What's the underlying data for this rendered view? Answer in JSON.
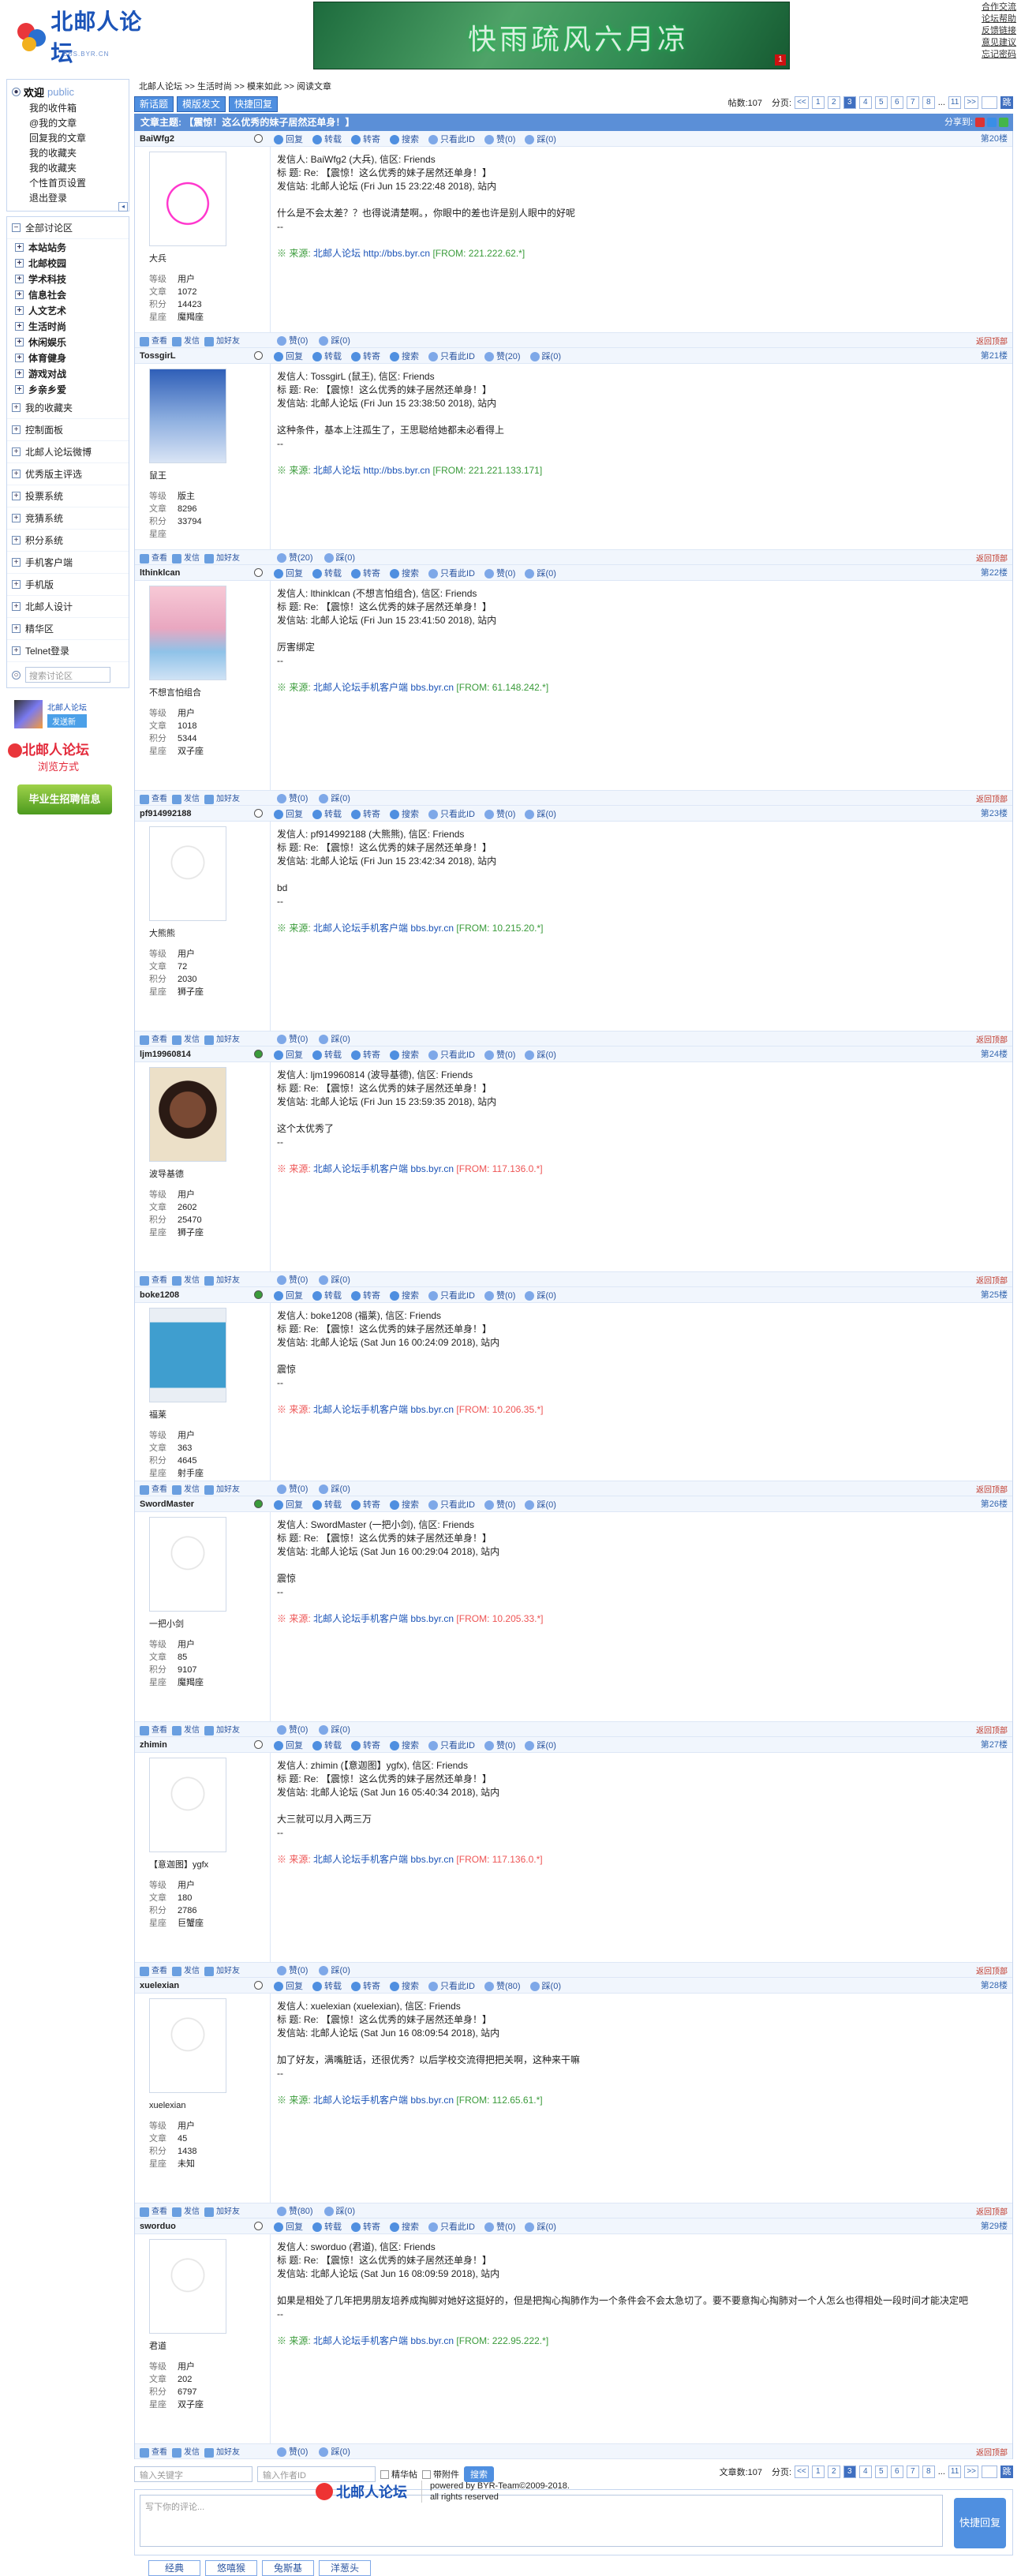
{
  "site": {
    "logo_text": "北邮人论坛",
    "logo_sub": "BBS.BYR.CN",
    "banner_text": "快雨疏风六月凉",
    "banner_badge": "1",
    "top_links": [
      "合作交流",
      "论坛帮助",
      "反馈链接",
      "意见建议",
      "忘记密码"
    ]
  },
  "sidebar": {
    "welcome_title": "欢迎",
    "welcome_user": "public",
    "welcome_links": [
      "我的收件箱",
      "@我的文章",
      "回复我的文章",
      "我的收藏夹",
      "我的收藏夹",
      "个性首页设置",
      "退出登录"
    ],
    "nav": [
      {
        "label": "全部讨论区",
        "boards": [
          "本站站务",
          "北邮校园",
          "学术科技",
          "信息社会",
          "人文艺术",
          "生活时尚",
          "休闲娱乐",
          "体育健身",
          "游戏对战",
          "乡亲乡爱"
        ]
      },
      {
        "label": "我的收藏夹"
      },
      {
        "label": "控制面板"
      },
      {
        "label": "北邮人论坛微博"
      },
      {
        "label": "优秀版主评选"
      },
      {
        "label": "投票系统"
      },
      {
        "label": "竞猜系统"
      },
      {
        "label": "积分系统"
      },
      {
        "label": "手机客户端"
      },
      {
        "label": "手机版"
      },
      {
        "label": "北邮人设计"
      },
      {
        "label": "精华区"
      },
      {
        "label": "Telnet登录"
      }
    ],
    "search_placeholder": "搜索讨论区",
    "ad_client": {
      "title": "北邮人论坛",
      "button": "发送新"
    },
    "ad_browse": {
      "line1": "北邮人论坛",
      "line2": "浏览方式"
    },
    "ad_job": "毕业生招聘信息"
  },
  "main": {
    "breadcrumb": [
      "北邮人论坛",
      ">>",
      "生活时尚",
      ">>",
      "模来如此",
      ">>",
      "阅读文章"
    ],
    "buttons": {
      "new_post": "新话题",
      "forward": "模版发文",
      "quick_reply": "快捷回复"
    },
    "post_count_label": "帖数:107",
    "pager_label": "分页:",
    "pages": [
      "<<",
      "1",
      "2",
      "3",
      "4",
      "5",
      "6",
      "7",
      "8",
      "...",
      "11",
      ">>"
    ],
    "current_page": "3",
    "go_label": "跳",
    "subject": "文章主题: 【震惊！这么优秀的妹子居然还单身！】",
    "share_label": "分享到:",
    "actions": {
      "reply": "回复",
      "forward": "转载",
      "cross": "转寄",
      "search": "搜索",
      "only_author": "只看此ID",
      "like": "赞",
      "dislike": "踩"
    },
    "user_actions": {
      "view": "查看",
      "message": "发信",
      "add_friend": "加好友"
    },
    "to_top": "返回顶部",
    "stat_labels": {
      "level": "等级",
      "posts": "文章",
      "score": "积分",
      "star": "星座"
    }
  },
  "posts": [
    {
      "id": "BaiWfg2",
      "floor": "第20楼",
      "nick": "大兵",
      "level": "用户",
      "posts": "1072",
      "score": "14423",
      "star": "魔羯座",
      "online": false,
      "from": "发信人: BaiWfg2 (大兵), 信区: Friends",
      "title": "标  题: Re: 【震惊！这么优秀的妹子居然还单身！】",
      "site": "发信站: 北邮人论坛 (Fri Jun 15 23:22:48 2018), 站内",
      "text": "什么是不会太差？？也得说清楚啊。，你眼中的差也许是别人眼中的好呢",
      "sig": "--",
      "src_prefix": "※ 来源: ",
      "src_name": "北邮人论坛",
      "src_url": "http://bbs.byr.cn",
      "src_from": "[FROM: 221.222.62.*]",
      "src_red": false,
      "top_like": "赞(0)",
      "top_dislike": "踩(0)",
      "bottom_like": "赞(0)",
      "bottom_dislike": "踩(0)"
    },
    {
      "id": "TossgirL",
      "floor": "第21楼",
      "nick": "鼠王",
      "level": "版主",
      "posts": "8296",
      "score": "33794",
      "star": "",
      "online": false,
      "from": "发信人: TossgirL (鼠王), 信区: Friends",
      "title": "标  题: Re: 【震惊！这么优秀的妹子居然还单身！】",
      "site": "发信站: 北邮人论坛 (Fri Jun 15 23:38:50 2018), 站内",
      "text": "这种条件，基本上注孤生了，王思聪给她都未必看得上",
      "sig": "--",
      "src_prefix": "※ 来源: ",
      "src_name": "北邮人论坛",
      "src_url": "http://bbs.byr.cn",
      "src_from": "[FROM: 221.221.133.171]",
      "src_red": false,
      "top_like": "赞(20)",
      "top_dislike": "踩(0)",
      "bottom_like": "赞(20)",
      "bottom_dislike": "踩(0)"
    },
    {
      "id": "lthinklcan",
      "floor": "第22楼",
      "nick": "不想言怕组合",
      "level": "用户",
      "posts": "1018",
      "score": "5344",
      "star": "双子座",
      "online": false,
      "from": "发信人: lthinklcan (不想言怕组合), 信区: Friends",
      "title": "标  题: Re: 【震惊！这么优秀的妹子居然还单身！】",
      "site": "发信站: 北邮人论坛 (Fri Jun 15 23:41:50 2018), 站内",
      "text": "厉害绑定",
      "sig": "--",
      "src_prefix": "※ 来源: ",
      "src_name": "北邮人论坛手机客户端",
      "src_url": "bbs.byr.cn",
      "src_from": "[FROM: 61.148.242.*]",
      "src_red": false,
      "top_like": "赞(0)",
      "top_dislike": "踩(0)",
      "bottom_like": "赞(0)",
      "bottom_dislike": "踩(0)"
    },
    {
      "id": "pf914992188",
      "floor": "第23楼",
      "nick": "大熊熊",
      "level": "用户",
      "posts": "72",
      "score": "2030",
      "star": "狮子座",
      "online": false,
      "from": "发信人: pf914992188 (大熊熊), 信区: Friends",
      "title": "标  题: Re: 【震惊！这么优秀的妹子居然还单身！】",
      "site": "发信站: 北邮人论坛 (Fri Jun 15 23:42:34 2018), 站内",
      "text": "bd",
      "sig": "--",
      "src_prefix": "※ 来源: ",
      "src_name": "北邮人论坛手机客户端",
      "src_url": "bbs.byr.cn",
      "src_from": "[FROM: 10.215.20.*]",
      "src_red": false,
      "top_like": "赞(0)",
      "top_dislike": "踩(0)",
      "bottom_like": "赞(0)",
      "bottom_dislike": "踩(0)"
    },
    {
      "id": "ljm19960814",
      "floor": "第24楼",
      "nick": "波导基德",
      "level": "用户",
      "posts": "2602",
      "score": "25470",
      "star": "狮子座",
      "online": true,
      "from": "发信人: ljm19960814 (波导基德), 信区: Friends",
      "title": "标  题: Re: 【震惊！这么优秀的妹子居然还单身！】",
      "site": "发信站: 北邮人论坛 (Fri Jun 15 23:59:35 2018), 站内",
      "text": "这个太优秀了",
      "sig": "--",
      "src_prefix": "※ 来源: ",
      "src_name": "北邮人论坛手机客户端",
      "src_url": "bbs.byr.cn",
      "src_from": "[FROM: 117.136.0.*]",
      "src_red": true,
      "top_like": "赞(0)",
      "top_dislike": "踩(0)",
      "bottom_like": "赞(0)",
      "bottom_dislike": "踩(0)"
    },
    {
      "id": "boke1208",
      "floor": "第25楼",
      "nick": "福莱",
      "level": "用户",
      "posts": "363",
      "score": "4645",
      "star": "射手座",
      "online": true,
      "from": "发信人: boke1208 (福莱), 信区: Friends",
      "title": "标  题: Re: 【震惊！这么优秀的妹子居然还单身！】",
      "site": "发信站: 北邮人论坛 (Sat Jun 16 00:24:09 2018), 站内",
      "text": "震惊",
      "sig": "--",
      "src_prefix": "※ 来源: ",
      "src_name": "北邮人论坛手机客户端",
      "src_url": "bbs.byr.cn",
      "src_from": "[FROM: 10.206.35.*]",
      "src_red": true,
      "top_like": "赞(0)",
      "top_dislike": "踩(0)",
      "bottom_like": "赞(0)",
      "bottom_dislike": "踩(0)"
    },
    {
      "id": "SwordMaster",
      "floor": "第26楼",
      "nick": "一把小剑",
      "level": "用户",
      "posts": "85",
      "score": "9107",
      "star": "魔羯座",
      "online": true,
      "from": "发信人: SwordMaster (一把小剑), 信区: Friends",
      "title": "标  题: Re: 【震惊！这么优秀的妹子居然还单身！】",
      "site": "发信站: 北邮人论坛 (Sat Jun 16 00:29:04 2018), 站内",
      "text": "震惊",
      "sig": "--",
      "src_prefix": "※ 来源: ",
      "src_name": "北邮人论坛手机客户端",
      "src_url": "bbs.byr.cn",
      "src_from": "[FROM: 10.205.33.*]",
      "src_red": true,
      "top_like": "赞(0)",
      "top_dislike": "踩(0)",
      "bottom_like": "赞(0)",
      "bottom_dislike": "踩(0)"
    },
    {
      "id": "zhimin",
      "floor": "第27楼",
      "nick": "【意迦图】ygfx",
      "level": "用户",
      "posts": "180",
      "score": "2786",
      "star": "巨蟹座",
      "online": false,
      "from": "发信人: zhimin (【意迦图】ygfx), 信区: Friends",
      "title": "标  题: Re: 【震惊！这么优秀的妹子居然还单身！】",
      "site": "发信站: 北邮人论坛 (Sat Jun 16 05:40:34 2018), 站内",
      "text": "大三就可以月入两三万",
      "sig": "--",
      "src_prefix": "※ 来源: ",
      "src_name": "北邮人论坛手机客户端",
      "src_url": "bbs.byr.cn",
      "src_from": "[FROM: 117.136.0.*]",
      "src_red": true,
      "top_like": "赞(0)",
      "top_dislike": "踩(0)",
      "bottom_like": "赞(0)",
      "bottom_dislike": "踩(0)"
    },
    {
      "id": "xuelexian",
      "floor": "第28楼",
      "nick": "xuelexian",
      "level": "用户",
      "posts": "45",
      "score": "1438",
      "star": "未知",
      "online": false,
      "from": "发信人: xuelexian (xuelexian), 信区: Friends",
      "title": "标  题: Re: 【震惊！这么优秀的妹子居然还单身！】",
      "site": "发信站: 北邮人论坛 (Sat Jun 16 08:09:54 2018), 站内",
      "text": "加了好友，满嘴脏话，还很优秀？以后学校交流得把把关啊，这种来干嘛",
      "sig": "--",
      "src_prefix": "※ 来源: ",
      "src_name": "北邮人论坛手机客户端",
      "src_url": "bbs.byr.cn",
      "src_from": "[FROM: 112.65.61.*]",
      "src_red": false,
      "top_like": "赞(80)",
      "top_dislike": "踩(0)",
      "bottom_like": "赞(80)",
      "bottom_dislike": "踩(0)"
    },
    {
      "id": "sworduo",
      "floor": "第29楼",
      "nick": "君道",
      "level": "用户",
      "posts": "202",
      "score": "6797",
      "star": "双子座",
      "online": false,
      "from": "发信人: sworduo (君道), 信区: Friends",
      "title": "标  题: Re: 【震惊！这么优秀的妹子居然还单身！】",
      "site": "发信站: 北邮人论坛 (Sat Jun 16 08:09:59 2018), 站内",
      "text": "如果是相处了几年把男朋友培养成掏脚对她好这挺好的，但是把掏心掏肺作为一个条件会不会太急切了。要不要意掏心掏肺对一个人怎么也得相处一段时间才能决定吧",
      "sig": "--",
      "src_prefix": "※ 来源: ",
      "src_name": "北邮人论坛手机客户端",
      "src_url": "bbs.byr.cn",
      "src_from": "[FROM: 222.95.222.*]",
      "src_red": false,
      "top_like": "赞(0)",
      "top_dislike": "踩(0)",
      "bottom_like": "赞(0)",
      "bottom_dislike": "踩(0)"
    }
  ],
  "bottom": {
    "keyword_placeholder": "输入关键字",
    "author_placeholder": "输入作者ID",
    "digest_label": "精华帖",
    "attach_label": "带附件",
    "search_button": "搜索",
    "post_count_label": "文章数:107",
    "reply_placeholder": "写下你的评论...",
    "quick_reply_button": "快捷回复",
    "emoticon_tabs": [
      "经典",
      "悠嘻猴",
      "兔斯基",
      "洋葱头"
    ]
  },
  "footer": {
    "logo": "北邮人论坛",
    "powered": "powered by BYR-Team©2009-2018.",
    "rights": "all rights reserved"
  },
  "colors": {
    "accent": "#4f8fe0",
    "header_bar": "#5b8fd7",
    "source_green": "#3a9b3a",
    "source_red": "#e55",
    "floor": "#3567b0"
  }
}
